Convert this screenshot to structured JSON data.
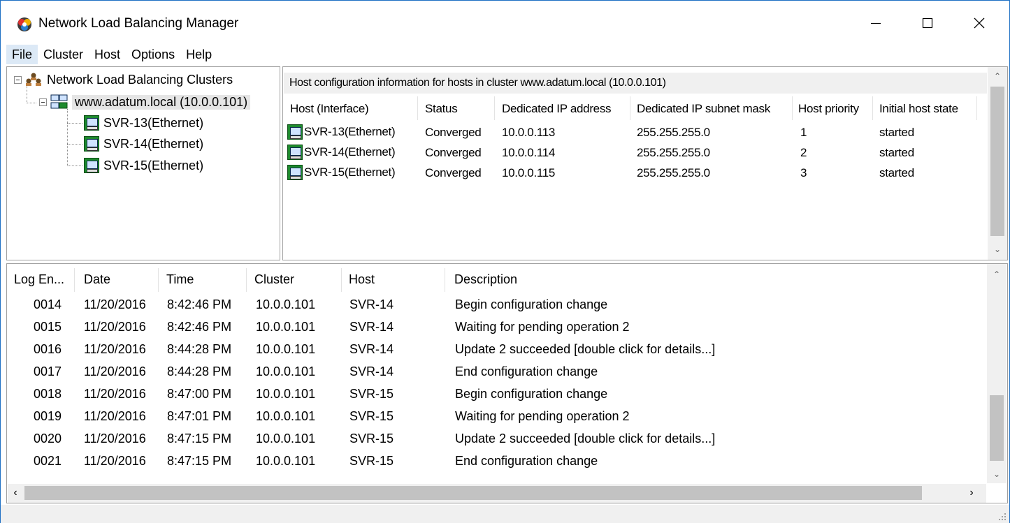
{
  "window": {
    "title": "Network Load Balancing Manager",
    "accent": "#1e6fc4",
    "icon": "nlb-manager-icon"
  },
  "menu": [
    {
      "label": "File"
    },
    {
      "label": "Cluster"
    },
    {
      "label": "Host"
    },
    {
      "label": "Options"
    },
    {
      "label": "Help"
    }
  ],
  "tree": {
    "root": {
      "label": "Network Load Balancing Clusters",
      "icon": "clusters-icon"
    },
    "cluster": {
      "label": "www.adatum.local (10.0.0.101)",
      "icon": "cluster-icon"
    },
    "hosts": [
      {
        "label": "SVR-13(Ethernet)",
        "icon": "host-icon"
      },
      {
        "label": "SVR-14(Ethernet)",
        "icon": "host-icon"
      },
      {
        "label": "SVR-15(Ethernet)",
        "icon": "host-icon"
      }
    ]
  },
  "host_info": {
    "header": "Host configuration information for hosts in cluster www.adatum.local (10.0.0.101)",
    "columns": [
      "Host (Interface)",
      "Status",
      "Dedicated IP address",
      "Dedicated IP subnet mask",
      "Host priority",
      "Initial host state"
    ],
    "rows": [
      [
        "SVR-13(Ethernet)",
        "Converged",
        "10.0.0.113",
        "255.255.255.0",
        "1",
        "started"
      ],
      [
        "SVR-14(Ethernet)",
        "Converged",
        "10.0.0.114",
        "255.255.255.0",
        "2",
        "started"
      ],
      [
        "SVR-15(Ethernet)",
        "Converged",
        "10.0.0.115",
        "255.255.255.0",
        "3",
        "started"
      ]
    ]
  },
  "log": {
    "columns": [
      "Log En...",
      "Date",
      "Time",
      "Cluster",
      "Host",
      "Description"
    ],
    "rows": [
      [
        "0014",
        "11/20/2016",
        "8:42:46 PM",
        "10.0.0.101",
        "SVR-14",
        "Begin configuration change"
      ],
      [
        "0015",
        "11/20/2016",
        "8:42:46 PM",
        "10.0.0.101",
        "SVR-14",
        "Waiting for pending operation 2"
      ],
      [
        "0016",
        "11/20/2016",
        "8:44:28 PM",
        "10.0.0.101",
        "SVR-14",
        "Update 2 succeeded [double click for details...]"
      ],
      [
        "0017",
        "11/20/2016",
        "8:44:28 PM",
        "10.0.0.101",
        "SVR-14",
        "End configuration change"
      ],
      [
        "0018",
        "11/20/2016",
        "8:47:00 PM",
        "10.0.0.101",
        "SVR-15",
        "Begin configuration change"
      ],
      [
        "0019",
        "11/20/2016",
        "8:47:01 PM",
        "10.0.0.101",
        "SVR-15",
        "Waiting for pending operation 2"
      ],
      [
        "0020",
        "11/20/2016",
        "8:47:15 PM",
        "10.0.0.101",
        "SVR-15",
        "Update 2 succeeded [double click for details...]"
      ],
      [
        "0021",
        "11/20/2016",
        "8:47:15 PM",
        "10.0.0.101",
        "SVR-15",
        "End configuration change"
      ]
    ]
  }
}
